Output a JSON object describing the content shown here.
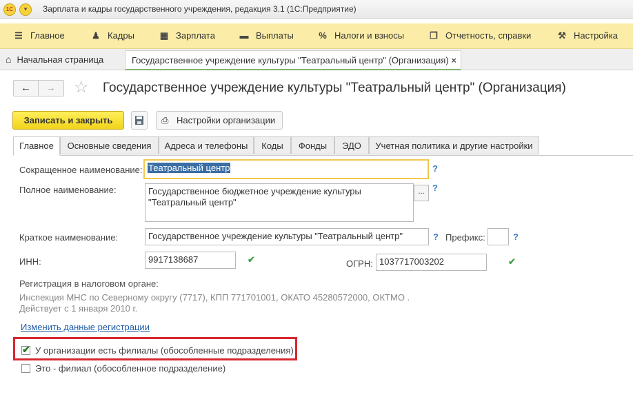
{
  "window": {
    "logo_text": "1С",
    "title": "Зарплата и кадры государственного учреждения, редакция 3.1  (1С:Предприятие)"
  },
  "main_menu": [
    {
      "icon": "menu-icon",
      "glyph": "☰",
      "label": "Главное"
    },
    {
      "icon": "staff-icon",
      "glyph": "👥",
      "label": "Кадры"
    },
    {
      "icon": "calculator-icon",
      "glyph": "▦",
      "label": "Зарплата"
    },
    {
      "icon": "payments-icon",
      "glyph": "▬",
      "label": "Выплаты"
    },
    {
      "icon": "percent-icon",
      "glyph": "%",
      "label": "Налоги и взносы"
    },
    {
      "icon": "reports-icon",
      "glyph": "❐",
      "label": "Отчетность, справки"
    },
    {
      "icon": "wrench-icon",
      "glyph": "🔧",
      "label": "Настройка"
    }
  ],
  "tabs_open": {
    "home": "Начальная страница",
    "current": "Государственное учреждение культуры \"Театральный центр\" (Организация)"
  },
  "form": {
    "title": "Государственное учреждение культуры \"Театральный центр\" (Организация)",
    "buttons": {
      "save_close": "Записать и закрыть",
      "settings": "Настройки организации"
    },
    "tabs": [
      "Главное",
      "Основные сведения",
      "Адреса и телефоны",
      "Коды",
      "Фонды",
      "ЭДО",
      "Учетная политика и другие настройки"
    ],
    "fields": {
      "short_name_label": "Сокращенное наименование:",
      "short_name_value": "Театральный центр",
      "full_name_label": "Полное наименование:",
      "full_name_value": "Государственное бюджетное учреждение культуры\n\"Театральный центр\"",
      "brief_name_label": "Краткое наименование:",
      "brief_name_value": "Государственное учреждение культуры \"Театральный центр\"",
      "prefix_label": "Префикс:",
      "prefix_value": "",
      "inn_label": "ИНН:",
      "inn_value": "9917138687",
      "ogrn_label": "ОГРН:",
      "ogrn_value": "1037717003202"
    },
    "registration": {
      "heading": "Регистрация в налоговом органе:",
      "line1": "Инспекция МНС по Северному округу (7717), КПП 771701001, ОКАТО 45280572000, ОКТМО .",
      "line2": "Действует с 1 января 2010 г.",
      "change_link": "Изменить данные регистрации"
    },
    "checkboxes": {
      "has_branches": "У организации есть филиалы (обособленные подразделения)",
      "has_branches_checked": true,
      "is_branch": "Это - филиал (обособленное подразделение)",
      "is_branch_checked": false
    },
    "help_mark": "?",
    "more_mark": "...",
    "check_mark": "✔"
  },
  "colors": {
    "menu_bg": "#fbeda7",
    "primary_button": "#f2d31a",
    "highlight_frame": "#d7262f",
    "link": "#1f5ea8"
  }
}
